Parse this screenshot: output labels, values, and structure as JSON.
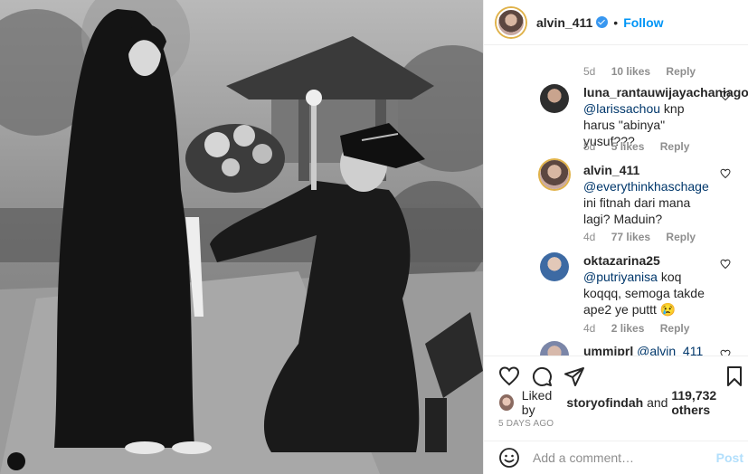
{
  "post": {
    "username": "alvin_411",
    "follow_label": "Follow",
    "separator": "•"
  },
  "comments": [
    {
      "time": "5d",
      "likes": "10 likes",
      "reply": "Reply"
    },
    {
      "username": "luna_rantauwijayachaniago",
      "mention": "@larissachou",
      "text": "knp harus \"abinya\" yusuf???",
      "time": "5d",
      "likes": "5 likes",
      "reply": "Reply"
    },
    {
      "username": "alvin_411",
      "mention": "@everythinkhaschage",
      "text": "ini fitnah dari mana lagi? Maduin?",
      "time": "4d",
      "likes": "77 likes",
      "reply": "Reply"
    },
    {
      "username": "oktazarina25",
      "mention": "@putriyanisa",
      "text": "koq koqqq, semoga takde ape2 ye puttt",
      "emoji": "😢",
      "time": "4d",
      "likes": "2 likes",
      "reply": "Reply"
    },
    {
      "username": "ummiprl",
      "mention": "@alvin_411"
    }
  ],
  "likes_line": {
    "prefix": "Liked by",
    "user": "storyofindah",
    "conj": "and",
    "count": "119,732 others"
  },
  "date": "5 DAYS AGO",
  "add_comment": {
    "placeholder": "Add a comment…",
    "post_label": "Post"
  },
  "colors": {
    "accent": "#0095f6",
    "post_disabled": "#b2dffc",
    "secondary_text": "#8e8e8e",
    "verified": "#3897f0"
  },
  "icons": [
    "verified-badge-icon",
    "heart-icon",
    "comment-icon",
    "share-icon",
    "bookmark-icon",
    "emoji-icon"
  ]
}
